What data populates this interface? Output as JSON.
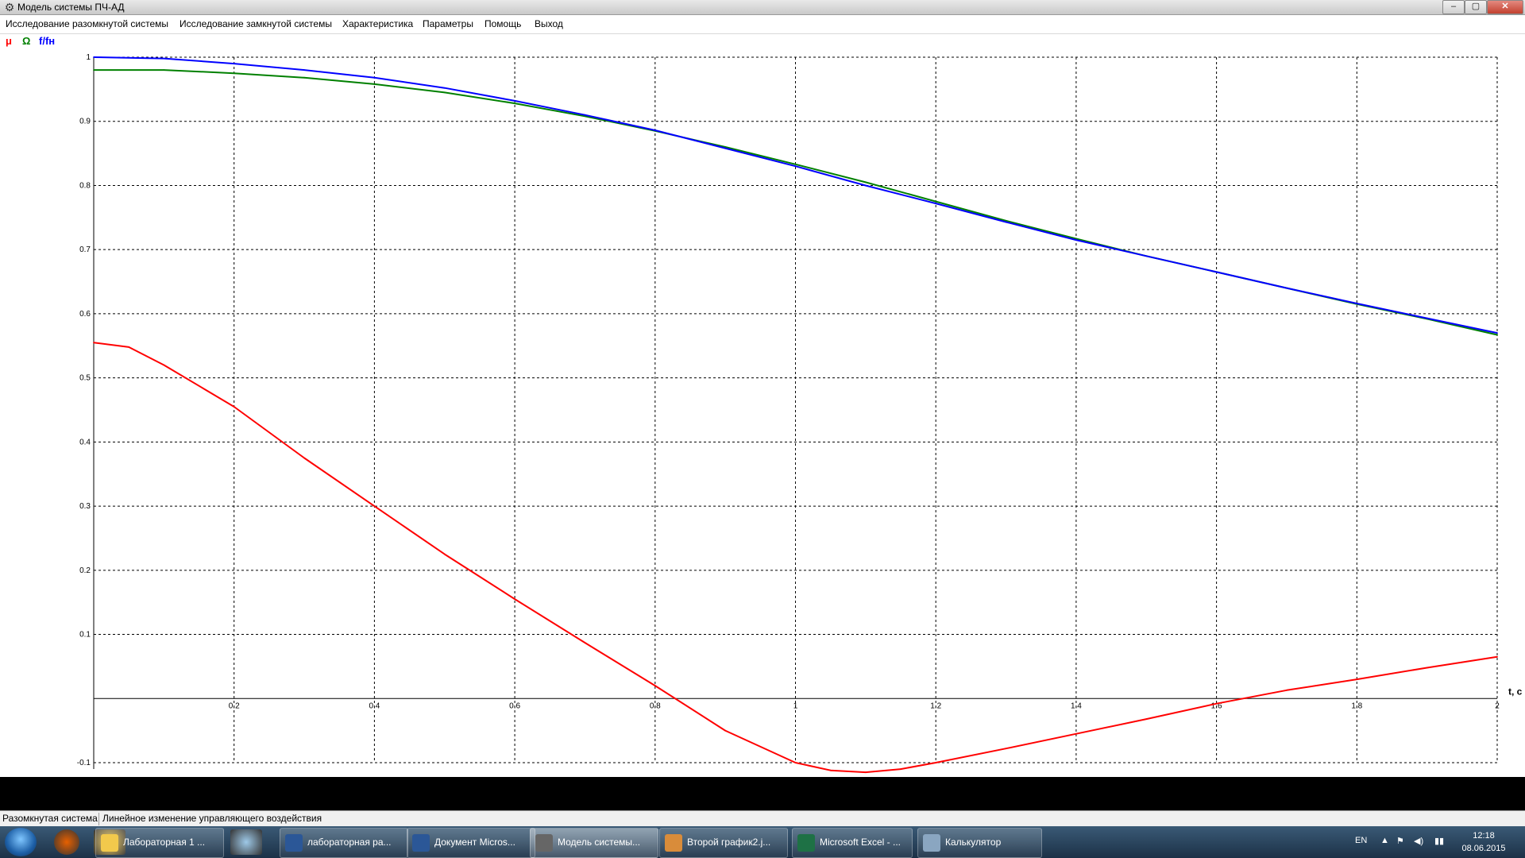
{
  "window": {
    "title": "Модель системы ПЧ-АД",
    "app_icon": "gear-icon",
    "controls": {
      "minimize": "–",
      "maximize": "▢",
      "close": "✕"
    }
  },
  "menu": [
    "Исследование разомкнутой системы",
    "Исследование замкнутой системы",
    "Характеристика",
    "Параметры",
    "Помощь",
    "Выход"
  ],
  "legend": [
    {
      "label": "μ",
      "color": "#ff0000"
    },
    {
      "label": "Ω",
      "color": "#008000"
    },
    {
      "label": "f/fн",
      "color": "#0000ff"
    }
  ],
  "chart_data": {
    "type": "line",
    "xlabel": "t, c",
    "ylabel": "",
    "xlim": [
      0,
      2
    ],
    "ylim": [
      -0.1,
      1
    ],
    "x_ticks": [
      "0.2",
      "0.4",
      "0.6",
      "0.8",
      "1",
      "1.2",
      "1.4",
      "1.6",
      "1.8",
      "2"
    ],
    "y_ticks": [
      "-0.1",
      "0.1",
      "0.2",
      "0.3",
      "0.4",
      "0.5",
      "0.6",
      "0.7",
      "0.8",
      "0.9",
      "1"
    ],
    "grid": true,
    "series": [
      {
        "name": "μ",
        "color": "#ff0000",
        "x": [
          0,
          0.05,
          0.1,
          0.2,
          0.3,
          0.4,
          0.5,
          0.6,
          0.7,
          0.8,
          0.9,
          1.0,
          1.05,
          1.1,
          1.15,
          1.2,
          1.3,
          1.4,
          1.5,
          1.6,
          1.7,
          1.8,
          1.9,
          2.0
        ],
        "values": [
          0.555,
          0.548,
          0.52,
          0.455,
          0.375,
          0.3,
          0.225,
          0.155,
          0.087,
          0.02,
          -0.05,
          -0.1,
          -0.112,
          -0.115,
          -0.11,
          -0.1,
          -0.078,
          -0.055,
          -0.032,
          -0.008,
          0.013,
          0.03,
          0.048,
          0.065
        ]
      },
      {
        "name": "Ω",
        "color": "#008000",
        "x": [
          0,
          0.1,
          0.2,
          0.3,
          0.4,
          0.5,
          0.6,
          0.7,
          0.8,
          0.9,
          1.0,
          1.1,
          1.2,
          1.3,
          1.4,
          1.5,
          1.6,
          1.7,
          1.8,
          1.9,
          2.0
        ],
        "values": [
          0.98,
          0.98,
          0.975,
          0.968,
          0.958,
          0.945,
          0.928,
          0.908,
          0.885,
          0.86,
          0.833,
          0.805,
          0.775,
          0.745,
          0.717,
          0.69,
          0.665,
          0.64,
          0.615,
          0.592,
          0.567
        ]
      },
      {
        "name": "f/fн",
        "color": "#0000ff",
        "x": [
          0,
          0.1,
          0.2,
          0.3,
          0.4,
          0.5,
          0.6,
          0.7,
          0.8,
          0.9,
          1.0,
          1.1,
          1.2,
          1.3,
          1.4,
          1.5,
          1.6,
          1.7,
          1.8,
          1.9,
          2.0
        ],
        "values": [
          1.0,
          0.998,
          0.99,
          0.98,
          0.968,
          0.952,
          0.932,
          0.91,
          0.886,
          0.858,
          0.83,
          0.8,
          0.772,
          0.743,
          0.715,
          0.69,
          0.665,
          0.64,
          0.616,
          0.593,
          0.57
        ]
      }
    ]
  },
  "statusbar": {
    "mode": "Разомкнутая система",
    "message": "Линейное изменение управляющего воздействия"
  },
  "taskbar": {
    "start_icon": "windows-start-icon",
    "pinned": [
      {
        "name": "firefox-icon",
        "color": "#e66000"
      },
      {
        "name": "folder-icon",
        "color": "#f2c94c"
      },
      {
        "name": "notepad-icon",
        "color": "#9ec9e8"
      }
    ],
    "buttons": [
      {
        "label": "Лабораторная 1 ...",
        "icon": "folder-icon",
        "color": "#f2c94c",
        "active": false
      },
      {
        "label": "лабораторная ра...",
        "icon": "word-icon",
        "color": "#2b5797",
        "active": false
      },
      {
        "label": "Документ Micros...",
        "icon": "word-icon",
        "color": "#2b5797",
        "active": false
      },
      {
        "label": "Модель системы...",
        "icon": "gear-icon",
        "color": "#666666",
        "active": true
      },
      {
        "label": "Второй график2.j...",
        "icon": "paint-icon",
        "color": "#d98c3a",
        "active": false
      },
      {
        "label": "Microsoft Excel - ...",
        "icon": "excel-icon",
        "color": "#1e7145",
        "active": false
      },
      {
        "label": "Калькулятор",
        "icon": "calculator-icon",
        "color": "#8aa6c1",
        "active": false
      }
    ],
    "lang": "EN",
    "tray_icons": [
      "show-hidden-icons-icon",
      "flag-icon",
      "volume-icon",
      "network-icon"
    ],
    "time": "12:18",
    "date": "08.06.2015"
  }
}
